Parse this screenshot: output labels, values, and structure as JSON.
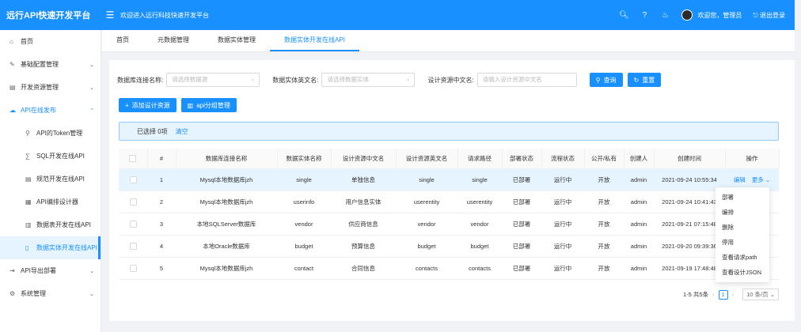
{
  "header": {
    "app_title": "远行API快速开发平台",
    "welcome": "欢迎进入远行科技快速开发平台",
    "greeting": "欢迎您，管理员",
    "logout": "退出登录"
  },
  "sidebar": {
    "home": "首页",
    "basic_config": "基础配置管理",
    "dev_resources": "开发资源管理",
    "api_publish": "API在线发布",
    "sub_items": [
      "API的Token管理",
      "SQL开发在线API",
      "规范开发在线API",
      "API编排设计器",
      "数据表开发在线API",
      "数据实体开发在线API"
    ],
    "api_export": "API导出部署",
    "system": "系统管理"
  },
  "tabs": [
    "首页",
    "元数据管理",
    "数据实体管理",
    "数据实体开发在线API"
  ],
  "search": {
    "db_label": "数据库连接名称:",
    "db_placeholder": "请选择数据源",
    "entity_label": "数据实体英文名:",
    "entity_placeholder": "请选择数据实体",
    "cn_label": "设计资源中文名:",
    "cn_placeholder": "请输入设计资源中文名",
    "query": "查询",
    "reset": "重置"
  },
  "actions": {
    "add": "添加设计资源",
    "group": "api分组管理"
  },
  "selection": {
    "text": "已选择 0项",
    "clear": "清空"
  },
  "table": {
    "headers": [
      "",
      "#",
      "数据库连接名称",
      "数据实体名称",
      "设计资源中文名",
      "设计资源英文名",
      "请求路径",
      "部署状态",
      "流程状态",
      "公开/私有",
      "创建人",
      "创建时间",
      "操作"
    ],
    "rows": [
      {
        "idx": "1",
        "db": "Mysql本地数据库jzh",
        "entity": "single",
        "cn": "单独信息",
        "en": "single",
        "path": "single",
        "deploy": "已部署",
        "flow": "运行中",
        "public": "开放",
        "creator": "admin",
        "time": "2021-09-24 10:55:34"
      },
      {
        "idx": "2",
        "db": "Mysql本地数据库jzh",
        "entity": "userinfo",
        "cn": "用户信息实体",
        "en": "userentity",
        "path": "userentity",
        "deploy": "已部署",
        "flow": "运行中",
        "public": "开放",
        "creator": "admin",
        "time": "2021-09-24 10:41:43"
      },
      {
        "idx": "3",
        "db": "本地SQLServer数据库",
        "entity": "vendor",
        "cn": "供应商信息",
        "en": "vendor",
        "path": "vendor",
        "deploy": "已部署",
        "flow": "运行中",
        "public": "开放",
        "creator": "admin",
        "time": "2021-09-21 07:15:48"
      },
      {
        "idx": "4",
        "db": "本地Oracle数据库",
        "entity": "budget",
        "cn": "预算信息",
        "en": "budget",
        "path": "budget",
        "deploy": "已部署",
        "flow": "运行中",
        "public": "开放",
        "creator": "admin",
        "time": "2021-09-20 09:39:36"
      },
      {
        "idx": "5",
        "db": "Mysql本地数据库jzh",
        "entity": "contact",
        "cn": "合同信息",
        "en": "contacts",
        "path": "contacts",
        "deploy": "已部署",
        "flow": "运行中",
        "public": "开放",
        "creator": "admin",
        "time": "2021-09-19 17:48:48"
      }
    ],
    "op_edit": "编辑",
    "op_more": "更多"
  },
  "dropdown": [
    "部署",
    "编排",
    "删除",
    "停用",
    "查看请求path",
    "查看设计JSON"
  ],
  "pagination": {
    "summary": "1-5 共5条",
    "current": "1",
    "page_size": "10 条/页"
  },
  "colors": {
    "primary": "#1890ff",
    "success": "#52c41a"
  }
}
